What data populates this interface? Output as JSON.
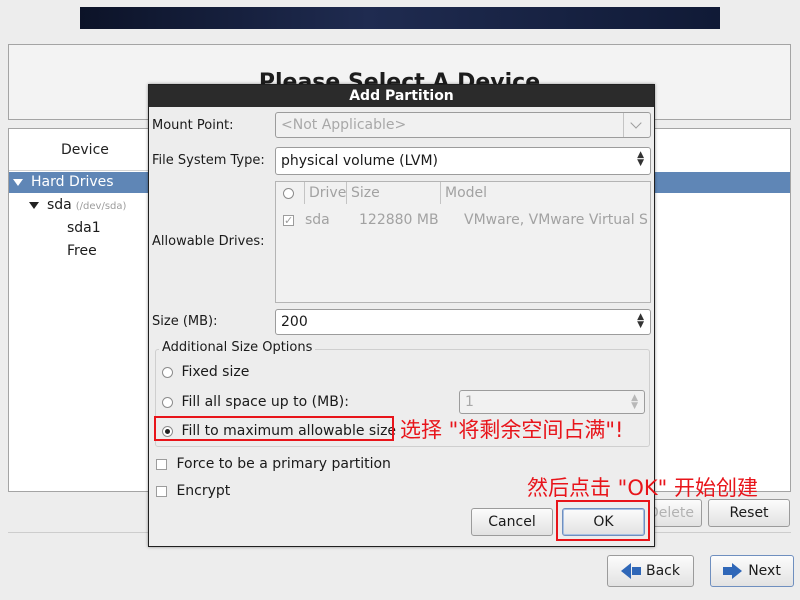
{
  "page": {
    "title": "Please Select A Device"
  },
  "device_panel": {
    "column_header": "Device",
    "tree": {
      "group": "Hard Drives",
      "disk": "sda",
      "disk_path": "(/dev/sda)",
      "partitions": [
        "sda1",
        "Free"
      ]
    }
  },
  "panel_buttons": {
    "delete": "Delete",
    "reset": "Reset"
  },
  "nav": {
    "back": "Back",
    "next": "Next"
  },
  "dialog": {
    "title": "Add Partition",
    "mount_point": {
      "label": "Mount Point:",
      "value": "<Not Applicable>"
    },
    "fs_type": {
      "label": "File System Type:",
      "value": "physical volume (LVM)"
    },
    "drives": {
      "label": "Allowable Drives:",
      "columns": [
        "Drive",
        "Size",
        "Model"
      ],
      "rows": [
        {
          "checked": true,
          "drive": "sda",
          "size": "122880 MB",
          "model": "VMware, VMware Virtual S"
        }
      ]
    },
    "size": {
      "label": "Size (MB):",
      "value": "200"
    },
    "size_options": {
      "title": "Additional Size Options",
      "fixed": "Fixed size",
      "fill_up_to": "Fill all space up to (MB):",
      "fill_up_to_value": "1",
      "fill_max": "Fill to maximum allowable size",
      "selected": "fill_max"
    },
    "primary": {
      "label": "Force to be a primary partition",
      "checked": false
    },
    "encrypt": {
      "label": "Encrypt",
      "checked": false
    },
    "cancel": "Cancel",
    "ok": "OK"
  },
  "annotations": {
    "note1": "选择 \"将剩余空间占满\"!",
    "note2": "然后点击 \"OK\" 开始创建"
  },
  "colors": {
    "annotation": "#e8141a",
    "selection": "#5f86b6",
    "arrow": "#2f67b8"
  }
}
